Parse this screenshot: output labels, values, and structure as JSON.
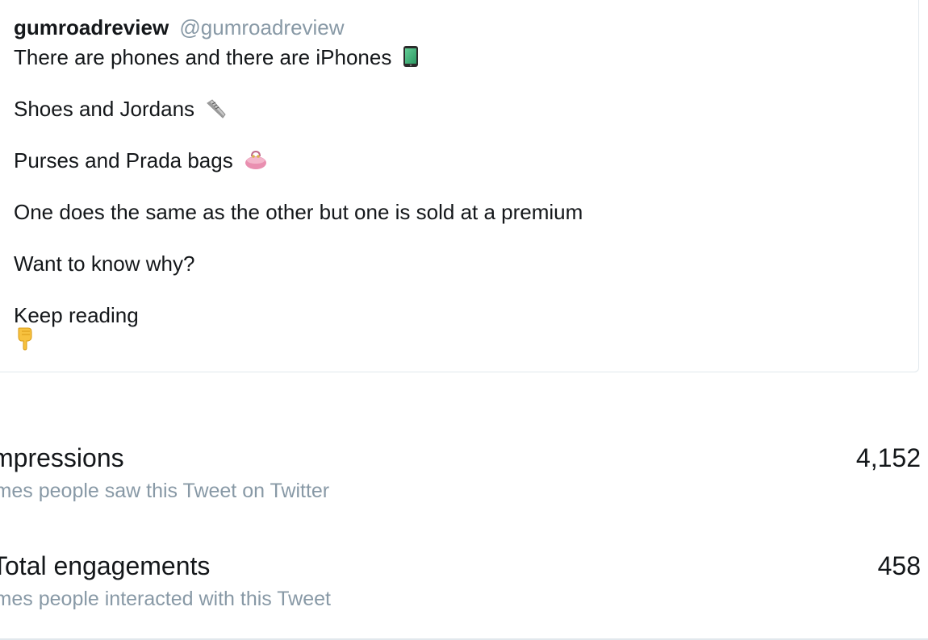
{
  "tweet": {
    "author_name": "gumroadreview",
    "author_handle": "@gumroadreview",
    "lines": [
      "There are phones and there are iPhones",
      "Shoes and Jordans",
      "Purses and Prada bags",
      "One does the same as the other but one is sold at a premium",
      "Want to know why?",
      "Keep reading"
    ],
    "emojis": [
      "mobile-phone-icon",
      "sneaker-icon",
      "purse-icon",
      "pointing-down-icon"
    ]
  },
  "metrics": {
    "impressions": {
      "label": "mpressions",
      "description": "imes people saw this Tweet on Twitter",
      "value": "4,152"
    },
    "engagements": {
      "label": "Total engagements",
      "description": "imes people interacted with this Tweet",
      "value": "458"
    }
  },
  "colors": {
    "text": "#14171a",
    "muted": "#8899a6",
    "border": "#e1e8ed"
  }
}
